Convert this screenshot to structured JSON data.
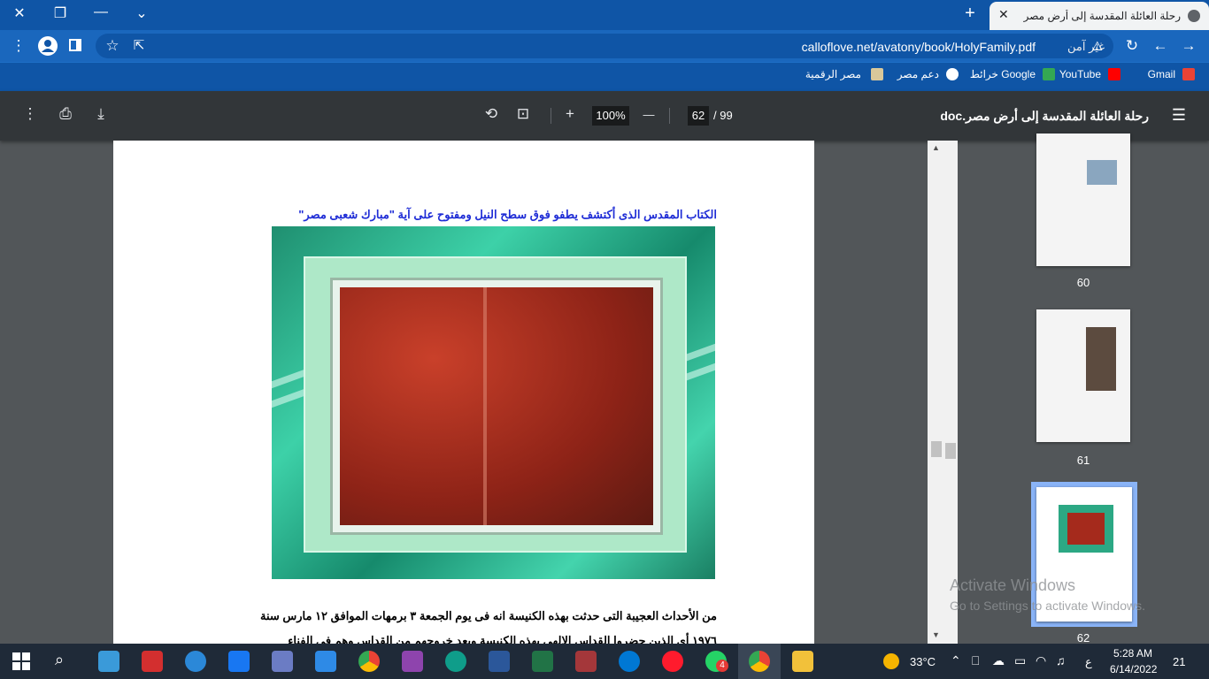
{
  "browser": {
    "tab_title": "رحلة العائلة المقدسة إلى أرض مصر",
    "url": "calloflove.net/avatony/book/HolyFamily.pdf",
    "security_label": "غير آمن",
    "window_controls": {
      "close": "✕",
      "restore": "❐",
      "minimize": "—",
      "tabs": "⌄"
    },
    "bookmarks": [
      {
        "label": "Gmail",
        "color": "#ea4335"
      },
      {
        "label": "YouTube",
        "color": "#ff0000"
      },
      {
        "label": "خرائط Google",
        "color": "#34a853"
      },
      {
        "label": "دعم مصر",
        "color": "#ffffff"
      },
      {
        "label": "مصر الرقمية",
        "color": "#d9c89a"
      }
    ]
  },
  "pdf": {
    "doc_title": "رحلة العائلة المقدسة إلى أرض مصر.doc",
    "page_current": "62",
    "page_total": "/ 99",
    "zoom": "100%",
    "zoom_in": "+",
    "zoom_out": "—",
    "page_caption": "الكتاب المقدس الذى أكتشف يطفو فوق سطح النيل ومفتوح على آية \"مبارك شعبى مصر\"",
    "body_line1": "من الأحداث العجيبة التى حدثت بهذه الكنيسة انه فى يوم الجمعة ٣ برمهات الموافق ١٢ مارس سنة",
    "body_line2": "١٩٧٦ أى الذين حضروا القداس الالهى بهذه الكنيسة وبعد خروجهم من القداس وهم فى الفناء",
    "thumbnails": [
      {
        "number": "60"
      },
      {
        "number": "61"
      },
      {
        "number": "62",
        "selected": true
      }
    ]
  },
  "watermark": {
    "line1": "Activate Windows",
    "line2": "Go to Settings to activate Windows."
  },
  "taskbar": {
    "apps": [
      {
        "name": "start",
        "color": "#ffffff"
      },
      {
        "name": "search",
        "color": "#ffffff"
      },
      {
        "name": "calculator-app",
        "color": "#3a9ad9"
      },
      {
        "name": "acrobat",
        "color": "#d32f2f"
      },
      {
        "name": "magnifier",
        "color": "#2b88d8"
      },
      {
        "name": "facebook",
        "color": "#1877f2"
      },
      {
        "name": "calculator",
        "color": "#6b7cc4"
      },
      {
        "name": "calendar",
        "color": "#2e8ae6"
      },
      {
        "name": "chrome",
        "color": "#4caf50"
      },
      {
        "name": "visual-studio",
        "color": "#8e44ad"
      },
      {
        "name": "edge",
        "color": "#0f9d8a"
      },
      {
        "name": "word",
        "color": "#2b579a"
      },
      {
        "name": "excel",
        "color": "#217346"
      },
      {
        "name": "access",
        "color": "#a4373a"
      },
      {
        "name": "sync",
        "color": "#0078d4"
      },
      {
        "name": "opera",
        "color": "#ff1b2d"
      },
      {
        "name": "whatsapp",
        "color": "#25d366",
        "badge": "4"
      },
      {
        "name": "chrome-active",
        "color": "#4caf50"
      },
      {
        "name": "file-explorer",
        "color": "#f2c13a"
      }
    ],
    "temperature": "33°C",
    "lang": "ع",
    "time": "5:28 AM",
    "date": "6/14/2022",
    "notifications": "21"
  }
}
